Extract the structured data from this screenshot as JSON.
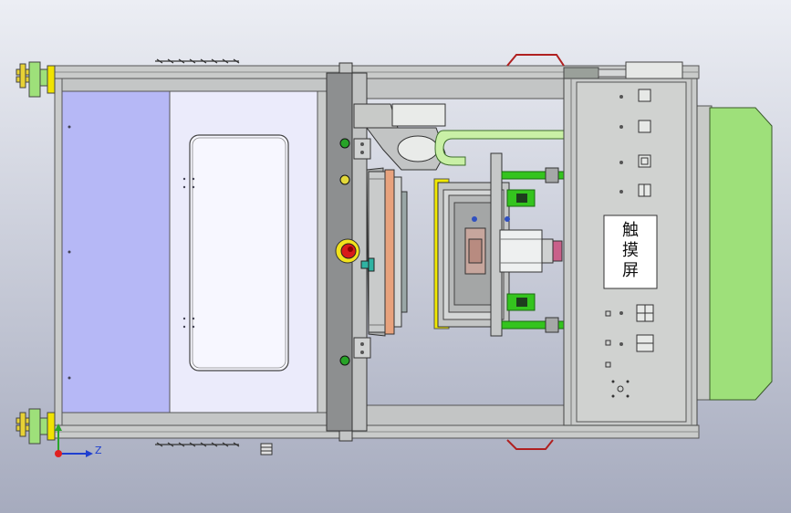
{
  "viewport": {
    "background_top": "#e9ebf2",
    "background_bottom": "#a9aec0"
  },
  "touchscreen": {
    "label": "触摸屏"
  },
  "triad": {
    "z_label": "Z"
  },
  "colors": {
    "frame": "#c8cac8",
    "frame_dark": "#7d7f80",
    "panel_blue": "#b6b8f6",
    "panel_light": "#ebebfb",
    "green_part": "#9ee07a",
    "green_rod": "#34c41e",
    "tube_green": "#c9f0a6",
    "yellow_accent": "#e8d235",
    "red_button": "#d81a1a",
    "orange_plate": "#e8a27d"
  }
}
